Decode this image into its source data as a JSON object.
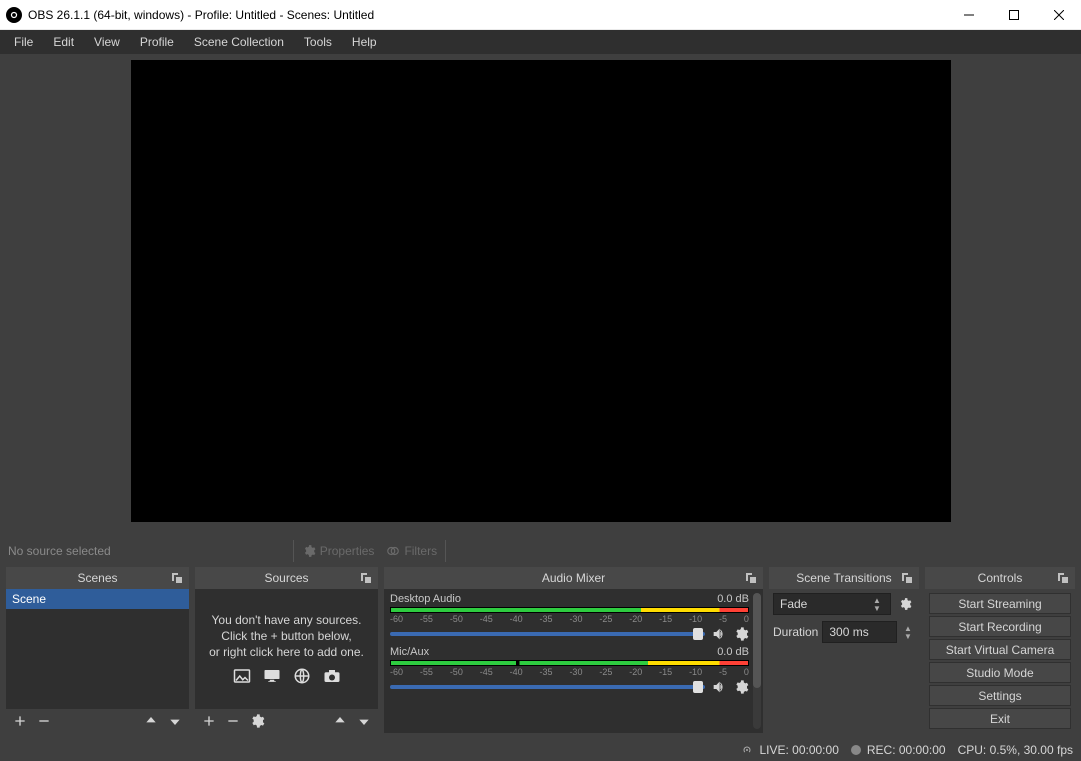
{
  "title": "OBS 26.1.1 (64-bit, windows) - Profile: Untitled - Scenes: Untitled",
  "menu": {
    "file": "File",
    "edit": "Edit",
    "view": "View",
    "profile": "Profile",
    "scene_collection": "Scene Collection",
    "tools": "Tools",
    "help": "Help"
  },
  "contextbar": {
    "no_source": "No source selected",
    "properties": "Properties",
    "filters": "Filters"
  },
  "docks": {
    "scenes": {
      "title": "Scenes",
      "items": [
        "Scene"
      ]
    },
    "sources": {
      "title": "Sources",
      "hint1": "You don't have any sources.",
      "hint2": "Click the + button below,",
      "hint3": "or right click here to add one."
    },
    "audio": {
      "title": "Audio Mixer",
      "channels": [
        {
          "name": "Desktop Audio",
          "level": "0.0 dB"
        },
        {
          "name": "Mic/Aux",
          "level": "0.0 dB"
        }
      ],
      "ticks": [
        "-60",
        "-55",
        "-50",
        "-45",
        "-40",
        "-35",
        "-30",
        "-25",
        "-20",
        "-15",
        "-10",
        "-5",
        "0"
      ]
    },
    "transitions": {
      "title": "Scene Transitions",
      "current": "Fade",
      "duration_label": "Duration",
      "duration_value": "300 ms"
    },
    "controls": {
      "title": "Controls",
      "buttons": {
        "start_streaming": "Start Streaming",
        "start_recording": "Start Recording",
        "start_virtual_camera": "Start Virtual Camera",
        "studio_mode": "Studio Mode",
        "settings": "Settings",
        "exit": "Exit"
      }
    }
  },
  "statusbar": {
    "live": "LIVE: 00:00:00",
    "rec": "REC: 00:00:00",
    "cpu": "CPU: 0.5%, 30.00 fps"
  }
}
